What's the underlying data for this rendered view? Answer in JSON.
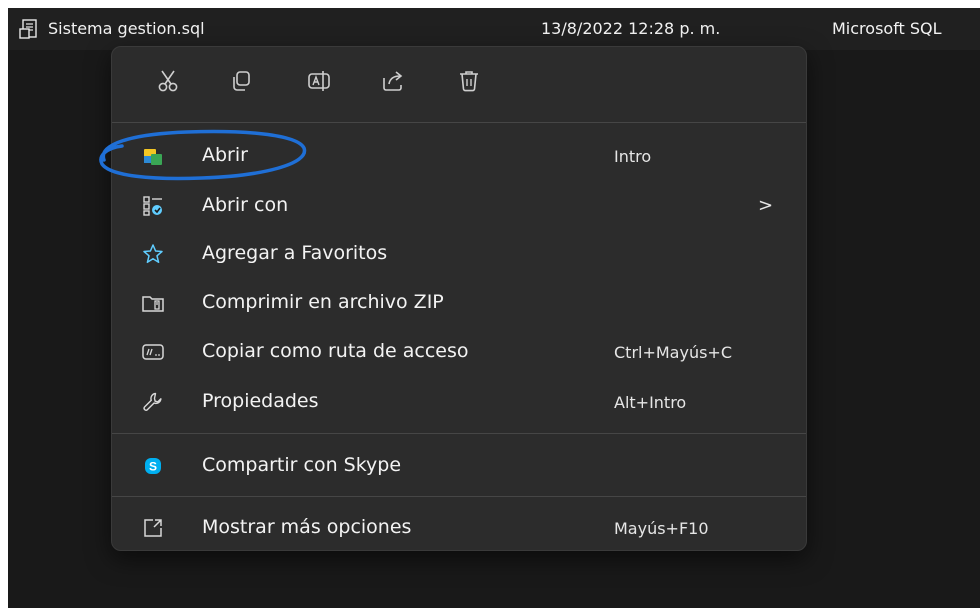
{
  "file": {
    "name": "Sistema gestion.sql",
    "date": "13/8/2022 12:28 p. m.",
    "type": "Microsoft SQL"
  },
  "toolbar": {
    "icons": [
      "cut-icon",
      "copy-icon",
      "rename-icon",
      "share-icon",
      "delete-icon"
    ]
  },
  "menu": {
    "items": [
      {
        "label": "Abrir",
        "shortcut": "Intro",
        "icon": "open-app-icon"
      },
      {
        "label": "Abrir con",
        "shortcut": ">",
        "icon": "open-with-icon"
      },
      {
        "label": "Agregar a Favoritos",
        "shortcut": "",
        "icon": "star-icon"
      },
      {
        "label": "Comprimir en archivo ZIP",
        "shortcut": "",
        "icon": "zip-folder-icon"
      },
      {
        "label": "Copiar como ruta de acceso",
        "shortcut": "Ctrl+Mayús+C",
        "icon": "copy-path-icon"
      },
      {
        "label": "Propiedades",
        "shortcut": "Alt+Intro",
        "icon": "wrench-icon"
      },
      {
        "label": "Compartir con Skype",
        "shortcut": "",
        "icon": "skype-icon"
      },
      {
        "label": "Mostrar más opciones",
        "shortcut": "Mayús+F10",
        "icon": "more-options-icon"
      }
    ]
  },
  "colors": {
    "background": "#191919",
    "menu_bg": "#2c2c2c",
    "accent_blue": "#60cdff",
    "annotation_blue": "#1f6fd6",
    "skype_blue": "#00aff0"
  }
}
